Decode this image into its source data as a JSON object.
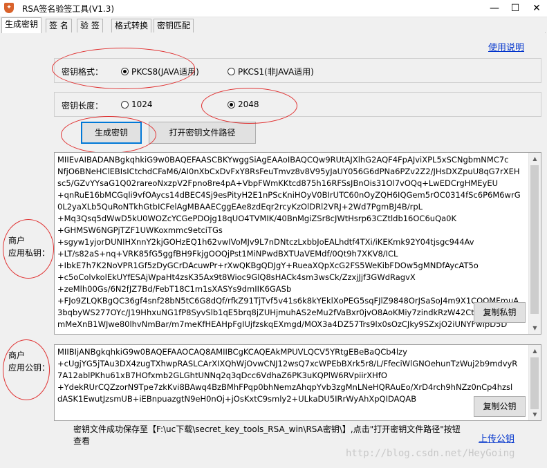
{
  "window": {
    "title": "RSA签名验签工具(V1.3)",
    "icon_name": "shield-app-icon",
    "minimize": "—",
    "maximize": "☐",
    "close": "✕"
  },
  "tabs": [
    {
      "label": "生成密钥",
      "active": true
    },
    {
      "label": "签 名",
      "active": false
    },
    {
      "label": "验 签",
      "active": false
    },
    {
      "label": "格式转换",
      "active": false
    },
    {
      "label": "密钥匹配",
      "active": false
    }
  ],
  "help_link": "使用说明",
  "key_format": {
    "label": "密钥格式：",
    "options": [
      {
        "label": "PKCS8(JAVA适用)",
        "checked": true
      },
      {
        "label": "PKCS1(非JAVA适用)",
        "checked": false
      }
    ]
  },
  "key_length": {
    "label": "密钥长度：",
    "options": [
      {
        "label": "1024",
        "checked": false
      },
      {
        "label": "2048",
        "checked": true
      }
    ]
  },
  "buttons": {
    "generate": "生成密钥",
    "open_path": "打开密钥文件路径",
    "copy_private": "复制私钥",
    "copy_public": "复制公钥"
  },
  "private_key": {
    "label_line1": "商户",
    "label_line2": "应用私钥：",
    "text": "MIIEvAIBADANBgkqhkiG9w0BAQEFAASCBKYwggSiAgEAAoIBAQCQw9RUtAJXlhG2AQF4FpAJviXPL5xSCNgbmNMC7c\nNfjO6BNeHClEBIsICtchdCFaM6/AI0nXbCxDvFxY8RsFeuTmvz8v8V95yJaUY056G6dPNa6PZv2Z2/JHsDXZpuU8qG7rXEH\nsc5/GZvYYsaG1Q02rareoNxzpV2Fpno8re4pA+VbpFWmKKtcd875h16RFSsJBnOis31Ol7vOQq+LwEDCrgHMEyEU\n+qnRuE16bMCGqli9vfOAycs14dBEC4Sj9esPityH2E1nPScKniHOyV0BIrUTC60nOyZQH6IQGem5rOC0314fSc6P6M6wrG\n0L2yaXLb5QuRoNTkhGtbICFelAgMBAAECggEAe8zdEqr2rcyKzOlDRl2VRJ+2Wd7PgmBJ4B/rpL\n+Mq3Qsq5dWwD5kU0WOZcYCGePDOjg18qUO4TVMIK/40BnMgiZSr8cJWtHsrp63CZtldb16OC6uQa0K\n+GHMSW6NGPjTZF1UWKoxmmc9etciTGs\n+sgyw1yjorDUNIHXnnY2kjGOHzEQ1h62vwIVoMJv9L7nDNtczLxbbJoEALhdtf4TXi/iKEKmk92Y04tjsgc944Av\n+LT/s82aS+nq+VRK85fG5ggfBH9FkjgOOQjPst1MiNPwdBXTUaVEMdf/0Qt9h7XKV8/ICL\n+IbkE7h7K2NoVPR1Gf5zDyGCrDAcuwPr+rXwQKBgQDJgY+RueaXQpXcG2FS5WeKibFDOw5gMNDfAycAT5o\n+c5oColvkolEkUYfESAjWpaHt4zsK35Ax9t8Wioc9GlQ8sHACk4sm3wsCk/ZzxjJjf3GWdRagvX\n+zeMlh00Gs/6N2fJZ7Bd/FebT18C1m1sXASYs9dmIIK6GASb\n+FJo9ZLQKBgQC36gf4snf28bN5tC6G8dQf/rfkZ91TjTvf5v41s6k8kYEklXoPEG5sqFJlZ9848OrJSaSoJ4m9X1CQOMFmuA\n3bqbyWS277OYc/J19HhxuNG1fP8SyvSlb1qE5brq8jZUHjmuhAS2eMu2fVaBxr0jvO8AoKMiy7zindkRzW42CtBCJaFgtX\nmMeXnB1WJwe80lhvNmBar/m7meKfHEAHpFgIUjfzskqEXmgd/MOX3a4DZ57Trs9lx0sOzCJky9SZxjO2iUNYFwIpD5D"
  },
  "public_key": {
    "label_line1": "商户",
    "label_line2": "应用公钥：",
    "text": "MIIBIjANBgkqhkiG9w0BAQEFAAOCAQ8AMIIBCgKCAQEAkMPUVLQCV5YRtgEBeBaQCb4lzy\n+cUgjYG5jTAu3DX4zugTXhwpRASLCArXIXQhWjOvwCNJ12wsQ7xcWPEbBXrk5r8/L/FfeciWlGNOehunTzWuj2b9mdvyR\n7A12ablPKhu61xB7HOfxmb2GLGhtUNNq2q3qDcc6VdhaZ6PK3uKQPlW6RVpiirXHfO\n+YdekRUrCQZzorN9Tpe7zkKvi8BAwq4BzBMhFPqp0bhNemzAhqpYvb3zgMnLNeHQRAuEo/XrD4rch9hNZz0nCp4hzsl\ndASK1EwutJzsmUB+iEBnpuazgtN9eH0nOj+jOsKxtC9smly2+ULkaDU5IRrWyAhXpQIDAQAB"
  },
  "status": {
    "message_line1": "密钥文件成功保存至【F:\\uc下载\\secret_key_tools_RSA_win\\RSA密钥\\】,点击\"打开密钥文件路径\"按钮",
    "message_line2": "查看",
    "upload_link": "上传公钥"
  },
  "watermark": "http://blog.csdn.net/HeyGoing",
  "colors": {
    "annotation_red": "#e03030",
    "link_blue": "#0033cc",
    "focus_blue": "#0078d7"
  }
}
